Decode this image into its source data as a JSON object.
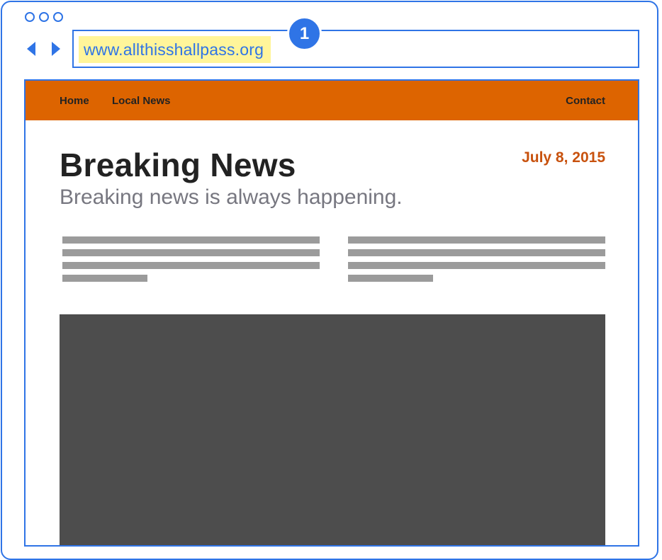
{
  "browser": {
    "url": "www.allthisshallpass.org",
    "step_number": "1"
  },
  "site": {
    "nav": {
      "home": "Home",
      "local_news": "Local News",
      "contact": "Contact"
    },
    "headline": "Breaking News",
    "subheadline": "Breaking news is always happening.",
    "date": "July 8, 2015"
  },
  "colors": {
    "accent": "#2f74e6",
    "nav_bar": "#dd6400",
    "date_text": "#c8520e",
    "url_highlight": "#fff59a",
    "placeholder_text": "#9b9b9b",
    "image_placeholder": "#4d4d4d"
  }
}
